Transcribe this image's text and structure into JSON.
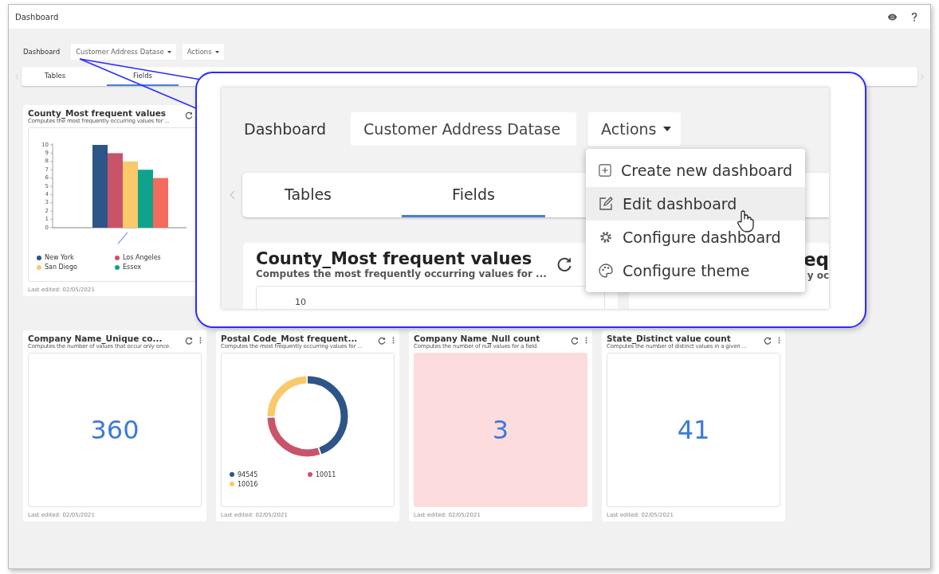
{
  "window": {
    "title": "Dashboard"
  },
  "toolbar": {
    "label": "Dashboard",
    "dataset_dropdown": "Customer Address Datase",
    "actions_button": "Actions"
  },
  "tabs": [
    {
      "label": "Tables",
      "selected": false
    },
    {
      "label": "Fields",
      "selected": true
    }
  ],
  "cards": [
    {
      "kind": "bar",
      "title": "County_Most frequent values",
      "subtitle": "Computes the most frequently occurring values for ...",
      "footer": "Last edited: 02/05/2021",
      "chart_data": {
        "type": "bar",
        "ylim": [
          0,
          10
        ],
        "yticks": [
          0,
          1,
          2,
          3,
          4,
          5,
          6,
          7,
          8,
          9,
          10
        ],
        "series": [
          {
            "name": "New York",
            "color": "#2d5587",
            "values": [
              10
            ]
          },
          {
            "name": "Los Angeles",
            "color": "#c9546a",
            "values": [
              9
            ]
          },
          {
            "name": "San Diego",
            "color": "#f9c96a",
            "values": [
              8
            ]
          },
          {
            "name": "Essex",
            "color": "#0fa38c",
            "values": [
              7
            ]
          },
          {
            "color": "#f36b5d",
            "values": [
              6
            ]
          }
        ]
      }
    },
    {
      "kind": "number",
      "title": "Company Name_Unique co...",
      "subtitle": "Computes the number of values that occur only once.",
      "value": "360",
      "alert": false,
      "footer": "Last edited: 02/05/2021"
    },
    {
      "kind": "donut",
      "title": "Postal Code_Most frequent...",
      "subtitle": "Computes the most frequently occurring values for ...",
      "legend": [
        {
          "label": "94545",
          "color": "#2d5587"
        },
        {
          "label": "10011",
          "color": "#c9546a"
        },
        {
          "label": "10016",
          "color": "#f9c96a"
        }
      ],
      "footer": "Last edited: 02/05/2021"
    },
    {
      "kind": "number",
      "title": "Company Name_Null count",
      "subtitle": "Computes the number of null values for a field.",
      "value": "3",
      "alert": true,
      "footer": "Last edited: 02/05/2021"
    },
    {
      "kind": "number",
      "title": "State_Distinct value count",
      "subtitle": "Computes the number of distinct values in a given ...",
      "value": "41",
      "alert": false,
      "footer": "Last edited: 02/05/2021"
    }
  ],
  "callout": {
    "toolbar": {
      "label": "Dashboard",
      "dataset_dropdown": "Customer Address Datase",
      "actions_button": "Actions"
    },
    "tabs": [
      {
        "label": "Tables",
        "selected": false
      },
      {
        "label": "Fields",
        "selected": true
      }
    ],
    "menu": [
      {
        "label": "Create new dashboard",
        "hovered": false
      },
      {
        "label": "Edit dashboard",
        "hovered": true
      },
      {
        "label": "Configure dashboard",
        "hovered": false
      },
      {
        "label": "Configure theme",
        "hovered": false
      }
    ],
    "card": {
      "title": "County_Most frequent values",
      "subtitle": "Computes the most frequently occurring values for ...",
      "axis_tick": "10"
    },
    "next_card": {
      "title": "eq",
      "subtitle": "y oc"
    }
  }
}
